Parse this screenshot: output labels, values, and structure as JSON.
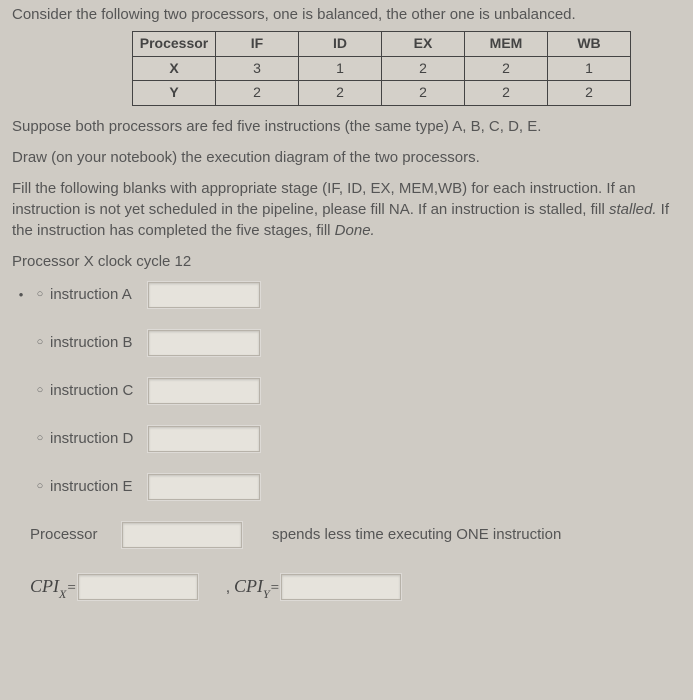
{
  "intro": "Consider the following two processors, one is balanced, the other one is unbalanced.",
  "table": {
    "headers": [
      "Processor",
      "IF",
      "ID",
      "EX",
      "MEM",
      "WB"
    ],
    "rows": [
      [
        "X",
        "3",
        "1",
        "2",
        "2",
        "1"
      ],
      [
        "Y",
        "2",
        "2",
        "2",
        "2",
        "2"
      ]
    ]
  },
  "para1": "Suppose both processors are fed five instructions (the same type) A, B, C, D, E.",
  "para2": "Draw (on your notebook) the execution diagram of the two processors.",
  "para3_a": "Fill the following blanks with appropriate stage (IF, ID, EX, MEM,WB) for each instruction. If an instruction is not yet scheduled in the pipeline, please fill NA. If an instruction is stalled, fill ",
  "para3_b": "stalled.",
  "para3_c": " If the instruction has completed the five stages, fill ",
  "para3_d": "Done.",
  "section": "Processor X clock cycle 12",
  "instructions": [
    {
      "label": "instruction A"
    },
    {
      "label": "instruction B"
    },
    {
      "label": "instruction C"
    },
    {
      "label": "instruction D"
    },
    {
      "label": "instruction E"
    }
  ],
  "processor_label": "Processor",
  "spends_text": "spends less time executing ONE instruction",
  "cpi_x": "CPI",
  "cpi_x_sub": "X",
  "cpi_y": "CPI",
  "cpi_y_sub": "Y",
  "equals": "=",
  "comma": ","
}
